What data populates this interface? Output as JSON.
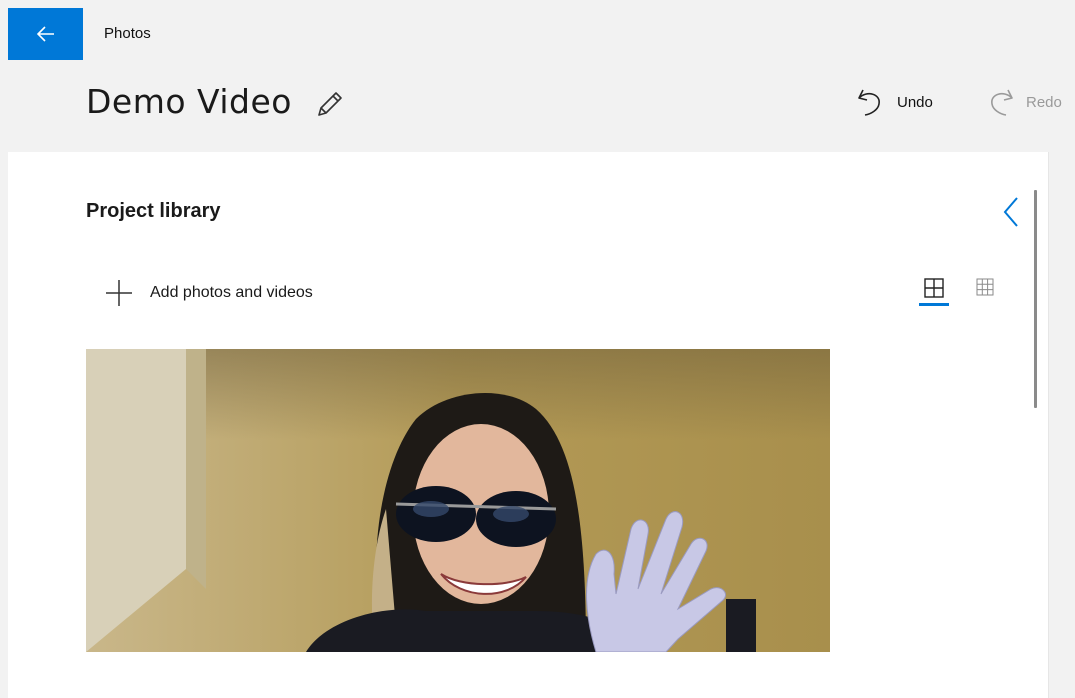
{
  "titlebar": {
    "app_name": "Photos",
    "back_icon": "arrow-left-icon",
    "accent_color": "#0078d7"
  },
  "header": {
    "project_title": "Demo Video",
    "rename_icon": "pencil-icon",
    "undo_label": "Undo",
    "undo_icon": "undo-icon",
    "redo_label": "Redo",
    "redo_icon": "redo-icon"
  },
  "library": {
    "heading": "Project library",
    "collapse_icon": "chevron-left-icon",
    "add_label": "Add photos and videos",
    "add_icon": "plus-icon",
    "view_large_icon": "large-grid-icon",
    "view_small_icon": "small-grid-icon",
    "selected_view": "large",
    "items": [
      {
        "kind": "video",
        "description_icon": "video-thumbnail"
      }
    ]
  }
}
